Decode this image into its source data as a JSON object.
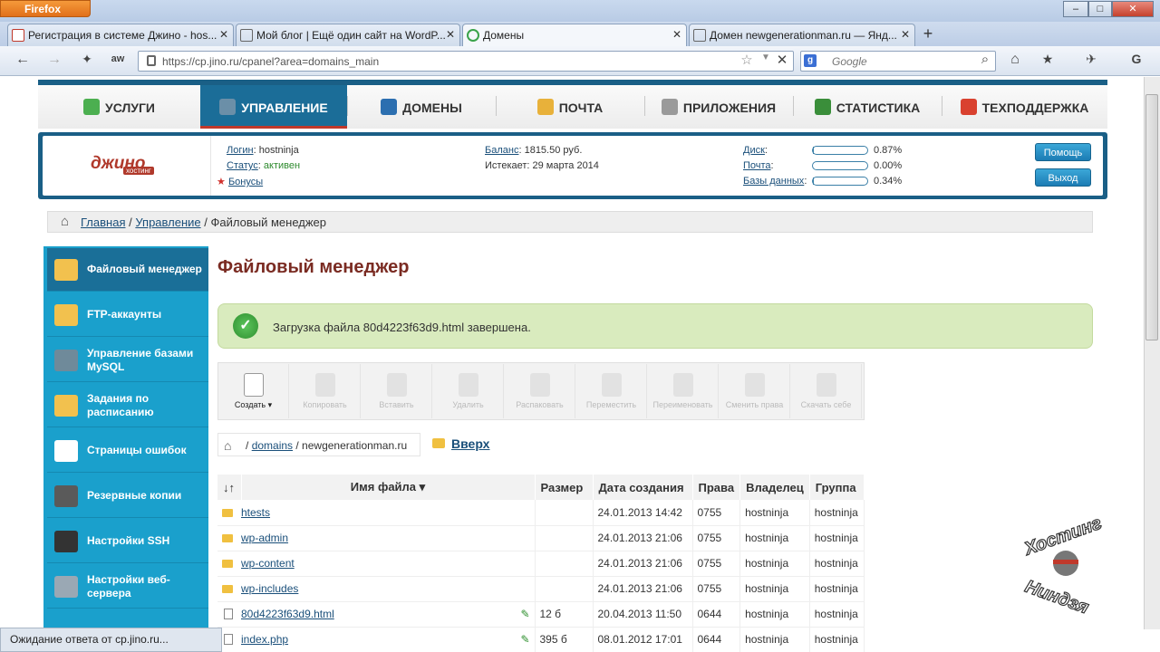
{
  "browser": {
    "app_label": "Firefox",
    "tabs": [
      {
        "label": "Регистрация в системе Джино - hos...",
        "icon": "gmail-icon"
      },
      {
        "label": "Мой блог | Ещё один сайт на WordP...",
        "icon": "blank-page-icon"
      },
      {
        "label": "Домены",
        "icon": "loading-icon"
      },
      {
        "label": "Домен newgenerationman.ru — Янд...",
        "icon": "mail-icon"
      }
    ],
    "url": "https://cp.jino.ru/cpanel?area=domains_main",
    "search_placeholder": "Google",
    "status": "Ожидание ответа от cp.jino.ru..."
  },
  "mainnav": [
    {
      "label": "УСЛУГИ",
      "color": "#4caf50"
    },
    {
      "label": "УПРАВЛЕНИЕ",
      "color": "#6b8fa8"
    },
    {
      "label": "ДОМЕНЫ",
      "color": "#2c6fb0"
    },
    {
      "label": "ПОЧТА",
      "color": "#e8b13a"
    },
    {
      "label": "ПРИЛОЖЕНИЯ",
      "color": "#9a9a9a"
    },
    {
      "label": "СТАТИСТИКА",
      "color": "#3a8e3a"
    },
    {
      "label": "ТЕХПОДДЕРЖКА",
      "color": "#d9412f"
    }
  ],
  "account": {
    "logo": "джино",
    "logo_sub": "хостинг",
    "login_label": "Логин",
    "login": "hostninja",
    "status_label": "Статус",
    "status": "активен",
    "bonus_label": "Бонусы",
    "balance_label": "Баланс",
    "balance": "1815.50 руб.",
    "expires": "Истекает: 29 марта 2014",
    "disk_label": "Диск",
    "disk": "0.87%",
    "disk_fraction": 0.0087,
    "mail_label": "Почта",
    "mail": "0.00%",
    "mail_fraction": 0.0,
    "db_label": "Базы данных",
    "db": "0.34%",
    "db_fraction": 0.0034,
    "help_btn": "Помощь",
    "exit_btn": "Выход"
  },
  "breadcrumb": {
    "home": "Главная",
    "sep1": "/",
    "section": "Управление",
    "sep2": "/",
    "current": "Файловый менеджер"
  },
  "sidebar": [
    {
      "label": "Файловый менеджер",
      "icon": "folder-icon"
    },
    {
      "label": "FTP-аккаунты",
      "icon": "folder-user-icon"
    },
    {
      "label": "Управление базами MySQL",
      "icon": "database-icon"
    },
    {
      "label": "Задания по расписанию",
      "icon": "clock-folder-icon"
    },
    {
      "label": "Страницы ошибок",
      "icon": "error-page-icon"
    },
    {
      "label": "Резервные копии",
      "icon": "backup-icon"
    },
    {
      "label": "Настройки SSH",
      "icon": "terminal-icon"
    },
    {
      "label": "Настройки веб-сервера",
      "icon": "server-settings-icon"
    }
  ],
  "content": {
    "title": "Файловый менеджер",
    "notice": "Загрузка файла 80d4223f63d9.html завершена."
  },
  "toolbar": [
    {
      "label": "Создать ▾",
      "icon": "new-file-icon"
    },
    {
      "label": "Копировать",
      "icon": "copy-icon"
    },
    {
      "label": "Вставить",
      "icon": "paste-icon"
    },
    {
      "label": "Удалить",
      "icon": "trash-icon"
    },
    {
      "label": "Распаковать",
      "icon": "unpack-icon"
    },
    {
      "label": "Переместить",
      "icon": "move-icon"
    },
    {
      "label": "Переименовать",
      "icon": "rename-icon"
    },
    {
      "label": "Сменить права",
      "icon": "permissions-icon"
    },
    {
      "label": "Скачать себе",
      "icon": "download-icon"
    }
  ],
  "path": {
    "sep": "/",
    "dir": "domains",
    "rest": "/ newgenerationman.ru",
    "up": "Вверх"
  },
  "table": {
    "sort_glyph": "↓↑",
    "headers": [
      "Имя файла ▾",
      "Размер",
      "Дата создания",
      "Права",
      "Владелец",
      "Группа"
    ],
    "rows": [
      {
        "name": "htests",
        "type": "folder",
        "size": "",
        "date": "24.01.2013 14:42",
        "perm": "0755",
        "owner": "hostninja",
        "group": "hostninja"
      },
      {
        "name": "wp-admin",
        "type": "folder",
        "size": "",
        "date": "24.01.2013 21:06",
        "perm": "0755",
        "owner": "hostninja",
        "group": "hostninja"
      },
      {
        "name": "wp-content",
        "type": "folder",
        "size": "",
        "date": "24.01.2013 21:06",
        "perm": "0755",
        "owner": "hostninja",
        "group": "hostninja"
      },
      {
        "name": "wp-includes",
        "type": "folder",
        "size": "",
        "date": "24.01.2013 21:06",
        "perm": "0755",
        "owner": "hostninja",
        "group": "hostninja"
      },
      {
        "name": "80d4223f63d9.html",
        "type": "file",
        "size": "12 б",
        "date": "20.04.2013 11:50",
        "perm": "0644",
        "owner": "hostninja",
        "group": "hostninja"
      },
      {
        "name": "index.php",
        "type": "file",
        "size": "395 б",
        "date": "08.01.2012 17:01",
        "perm": "0644",
        "owner": "hostninja",
        "group": "hostninja"
      }
    ]
  },
  "watermark": {
    "top": "Хостинг",
    "bottom": "Ниндзя"
  }
}
